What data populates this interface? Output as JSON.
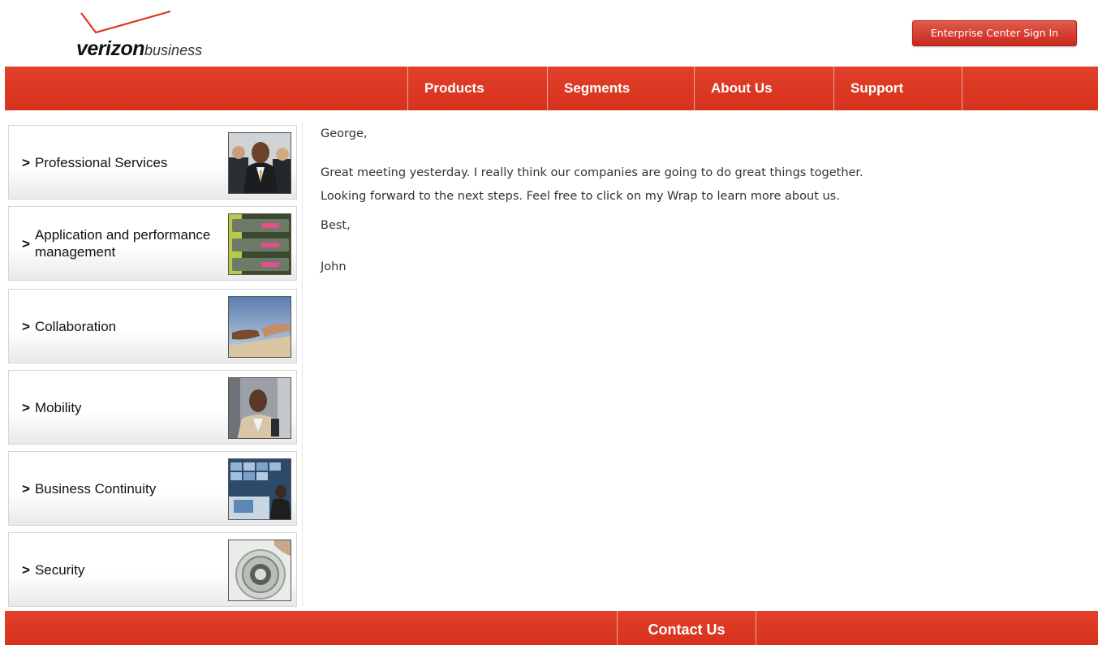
{
  "brand": {
    "logo_word": "verizon",
    "logo_sub": "business",
    "accent_color": "#d9361f",
    "checkmark_color": "#d9361f"
  },
  "header": {
    "signin_label": "Enterprise Center Sign In"
  },
  "nav": {
    "items": [
      {
        "label": "Products"
      },
      {
        "label": "Segments"
      },
      {
        "label": "About Us"
      },
      {
        "label": "Support"
      }
    ]
  },
  "sidebar": {
    "chevron": ">",
    "items": [
      {
        "label": "Professional Services",
        "icon": "business-people-photo"
      },
      {
        "label": "Application and performance management",
        "icon": "server-racks-photo"
      },
      {
        "label": "Collaboration",
        "icon": "handshake-photo"
      },
      {
        "label": "Mobility",
        "icon": "businessman-photo"
      },
      {
        "label": "Business Continuity",
        "icon": "control-room-photo"
      },
      {
        "label": "Security",
        "icon": "vault-dial-photo"
      }
    ]
  },
  "message": {
    "greeting": "George,",
    "line1": "Great meeting yesterday.  I really think our companies are going to do great things together.",
    "line2": "Looking forward to the next steps.  Feel free to click on my Wrap to learn more about us.",
    "closing": "Best,",
    "signature": "John"
  },
  "footer": {
    "contact_label": "Contact Us"
  }
}
